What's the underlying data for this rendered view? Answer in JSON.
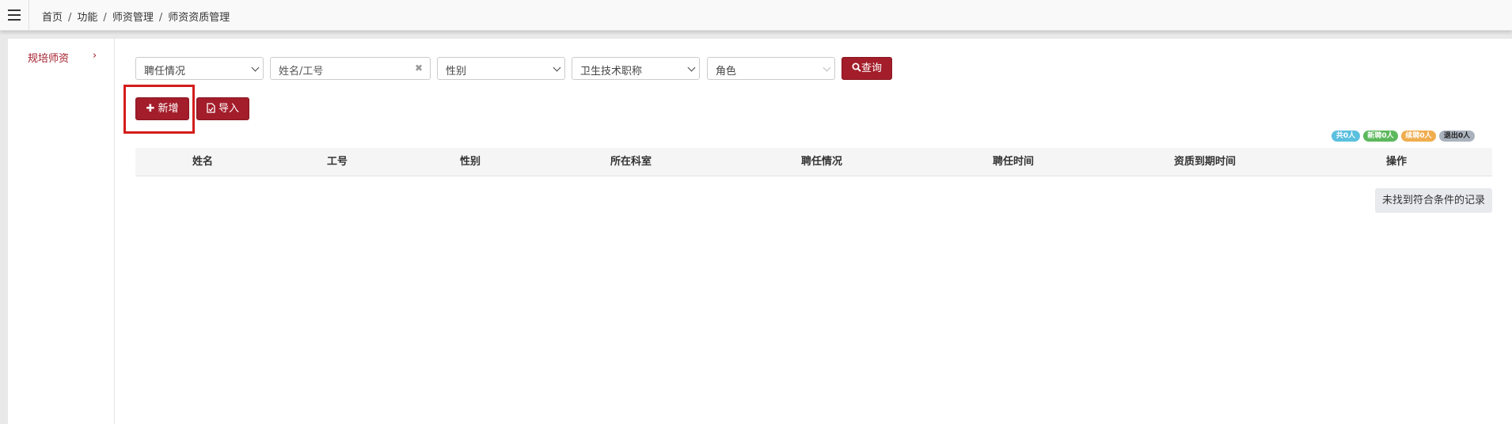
{
  "breadcrumb": [
    "首页",
    "功能",
    "师资管理",
    "师资资质管理"
  ],
  "breadcrumb_separator": "/",
  "sidebar": {
    "items": [
      {
        "label": "规培师资",
        "chevron": "›"
      }
    ]
  },
  "filters": {
    "employment": "聘任情况",
    "name_placeholder": "姓名/工号",
    "gender": "性别",
    "title": "卫生技术职称",
    "role": "角色",
    "query_label": "查询"
  },
  "toolbar": {
    "add_label": "新增",
    "import_label": "导入"
  },
  "stats": {
    "total": "共0人",
    "new_hire": "新聘0人",
    "renew": "续聘0人",
    "exit": "退出0人"
  },
  "table": {
    "columns": [
      "姓名",
      "工号",
      "性别",
      "所在科室",
      "聘任情况",
      "聘任时间",
      "资质到期时间",
      "操作"
    ],
    "rows": [],
    "empty_text": "未找到符合条件的记录"
  },
  "colors": {
    "accent": "#a31d2a",
    "badge_total": "#5bc0de",
    "badge_new": "#5cb85c",
    "badge_renew": "#f0ad4e",
    "badge_exit": "#aab2bd"
  }
}
